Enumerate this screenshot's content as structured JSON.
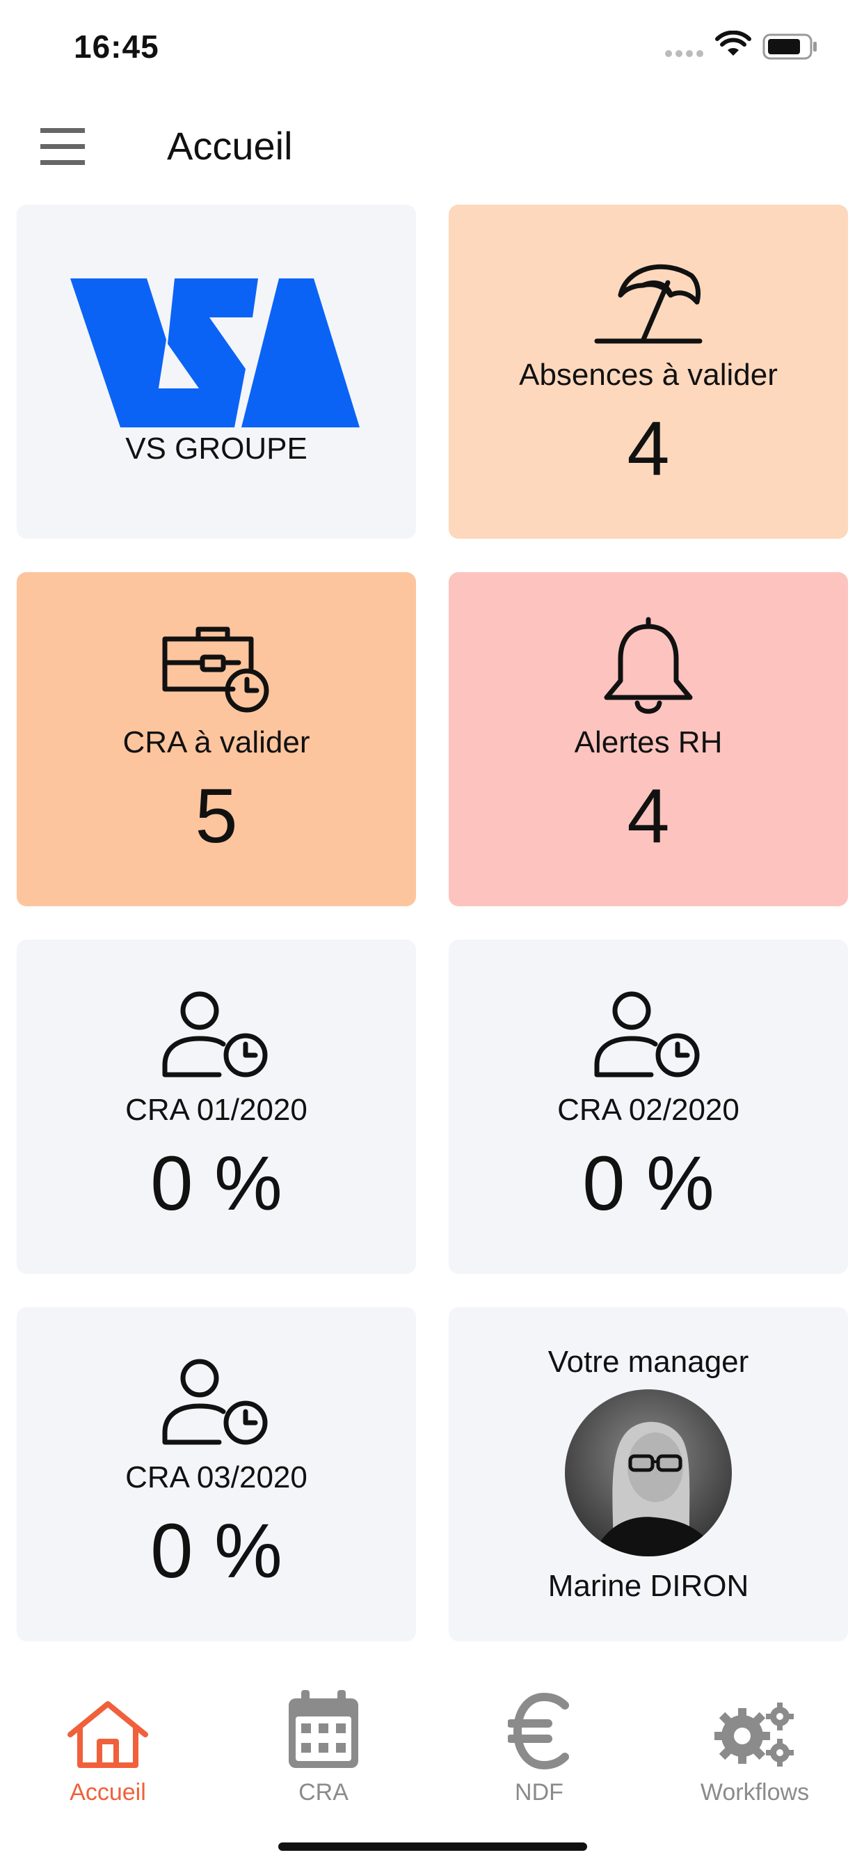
{
  "status_bar": {
    "time": "16:45"
  },
  "header": {
    "title": "Accueil",
    "menu_icon": "hamburger-menu-icon"
  },
  "tiles": {
    "company": {
      "name": "VS GROUPE",
      "logo_text": "VSA",
      "logo_color": "#0b63f6"
    },
    "absences": {
      "label": "Absences à valider",
      "value": "4",
      "icon": "beach-umbrella-icon",
      "color": "#fdd8bd"
    },
    "cra_validate": {
      "label": "CRA à valider",
      "value": "5",
      "icon": "briefcase-clock-icon",
      "color": "#fdc59e"
    },
    "alerts": {
      "label": "Alertes RH",
      "value": "4",
      "icon": "bell-icon",
      "color": "#fdc4bf"
    },
    "cra_01": {
      "label": "CRA 01/2020",
      "value": "0 %",
      "icon": "user-clock-icon"
    },
    "cra_02": {
      "label": "CRA 02/2020",
      "value": "0 %",
      "icon": "user-clock-icon"
    },
    "cra_03": {
      "label": "CRA 03/2020",
      "value": "0 %",
      "icon": "user-clock-icon"
    },
    "manager": {
      "title": "Votre manager",
      "name": "Marine DIRON"
    }
  },
  "tab_bar": {
    "active_color": "#f0603b",
    "inactive_color": "#8b8b8b",
    "items": [
      {
        "label": "Accueil",
        "icon": "home-icon",
        "active": true
      },
      {
        "label": "CRA",
        "icon": "calendar-icon",
        "active": false
      },
      {
        "label": "NDF",
        "icon": "euro-icon",
        "active": false
      },
      {
        "label": "Workflows",
        "icon": "gears-icon",
        "active": false
      }
    ]
  }
}
